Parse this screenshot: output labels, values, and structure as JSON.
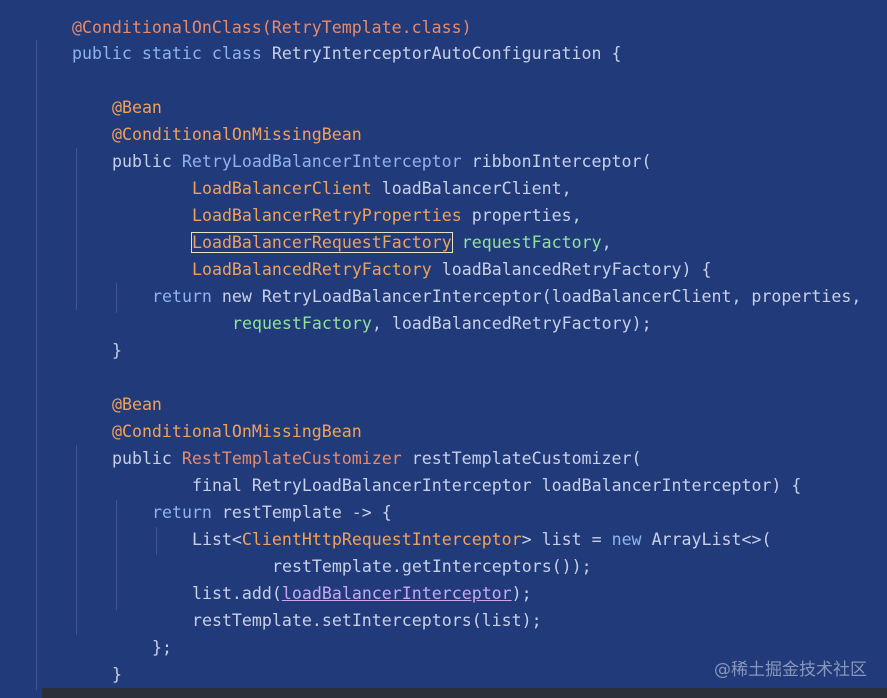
{
  "code": {
    "l0": "@ConditionalOnClass(RetryTemplate.class)",
    "l1_public": "public",
    "l1_static": "static",
    "l1_class": "class",
    "l1_name": "RetryInterceptorAutoConfiguration",
    "l1_brace": "{",
    "bean1": "@Bean",
    "cond1": "@ConditionalOnMissingBean",
    "m1_public": "public",
    "m1_type": "RetryLoadBalancerInterceptor",
    "m1_name": "ribbonInterceptor(",
    "p1_type": "LoadBalancerClient",
    "p1_name": "loadBalancerClient,",
    "p2_type": "LoadBalancerRetryProperties",
    "p2_name": "properties,",
    "p3_type": "LoadBalancerRequestFactory",
    "p3_name": "requestFactory",
    "p3_comma": ",",
    "p4_type": "LoadBalancedRetryFactory",
    "p4_name": "loadBalancedRetryFactory) {",
    "r1_return": "return",
    "r1_new": "new",
    "r1_type": "RetryLoadBalancerInterceptor(loadBalancerClient, properties,",
    "r1b_name": "requestFactory",
    "r1b_rest": ", loadBalancedRetryFactory);",
    "close1": "}",
    "bean2": "@Bean",
    "cond2": "@ConditionalOnMissingBean",
    "m2_public": "public",
    "m2_type": "RestTemplateCustomizer",
    "m2_name": "restTemplateCustomizer(",
    "q1_final": "final",
    "q1_type": "RetryLoadBalancerInterceptor",
    "q1_name": "loadBalancerInterceptor) {",
    "r2_return": "return",
    "r2_rest": "restTemplate -> {",
    "list_type1": "List<",
    "list_type2": "ClientHttpRequestInterceptor",
    "list_rest1": "> list = ",
    "list_new": "new",
    "list_type3": "ArrayList<>(",
    "list2": "restTemplate.getInterceptors());",
    "add_a": "list.add(",
    "add_b": "loadBalancerInterceptor",
    "add_c": ");",
    "set": "restTemplate.setInterceptors(list);",
    "close_lambda": "};",
    "close2": "}"
  },
  "watermark": "@稀土掘金技术社区"
}
